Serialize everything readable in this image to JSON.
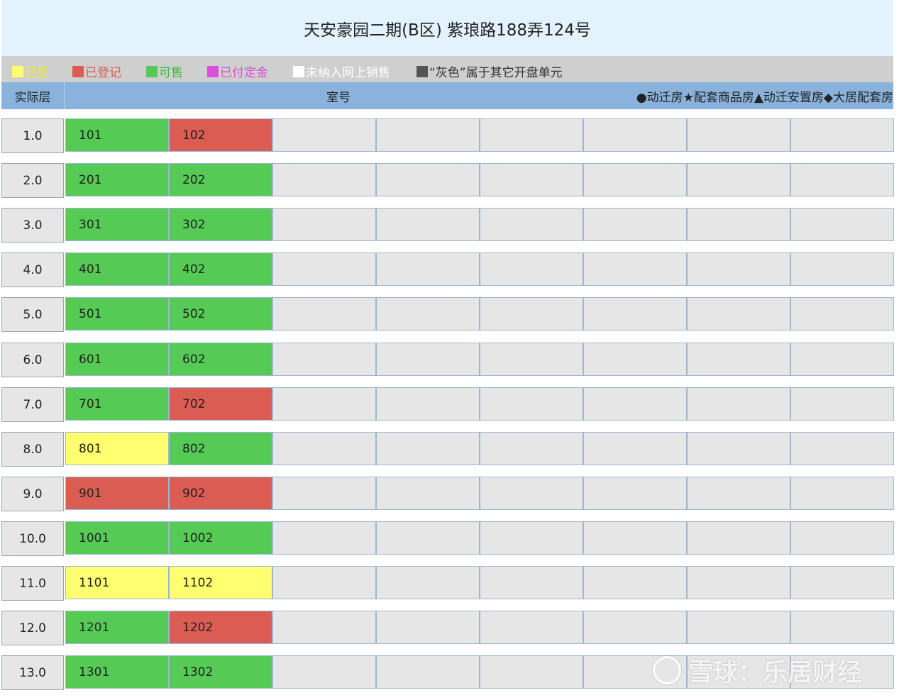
{
  "title": "天安豪园二期(B区) 紫琅路188弄124号",
  "legend": [
    {
      "label": "已签",
      "color": "#ffff70",
      "text_color": "#e6e600"
    },
    {
      "label": "已登记",
      "color": "#db5c53",
      "text_color": "#db5c53"
    },
    {
      "label": "可售",
      "color": "#55cb55",
      "text_color": "#3fb83f"
    },
    {
      "label": "已付定金",
      "color": "#d94fd9",
      "text_color": "#d94fd9"
    },
    {
      "label": "未纳入网上销售",
      "color": "#ffffff",
      "text_color": "#ffffff"
    },
    {
      "label": "“灰色”属于其它开盘单元",
      "color": "#555555",
      "text_color": "#333333"
    }
  ],
  "header": {
    "floor_label": "实际层",
    "room_label": "室号",
    "type_legend": "●动迁房★配套商品房▲动迁安置房◆大居配套房"
  },
  "rows": [
    {
      "floor": "1.0",
      "units": [
        {
          "num": "101",
          "status": "green"
        },
        {
          "num": "102",
          "status": "red"
        }
      ]
    },
    {
      "floor": "2.0",
      "units": [
        {
          "num": "201",
          "status": "green"
        },
        {
          "num": "202",
          "status": "green"
        }
      ]
    },
    {
      "floor": "3.0",
      "units": [
        {
          "num": "301",
          "status": "green"
        },
        {
          "num": "302",
          "status": "green"
        }
      ]
    },
    {
      "floor": "4.0",
      "units": [
        {
          "num": "401",
          "status": "green"
        },
        {
          "num": "402",
          "status": "green"
        }
      ]
    },
    {
      "floor": "5.0",
      "units": [
        {
          "num": "501",
          "status": "green"
        },
        {
          "num": "502",
          "status": "green"
        }
      ]
    },
    {
      "floor": "6.0",
      "units": [
        {
          "num": "601",
          "status": "green"
        },
        {
          "num": "602",
          "status": "green"
        }
      ]
    },
    {
      "floor": "7.0",
      "units": [
        {
          "num": "701",
          "status": "green"
        },
        {
          "num": "702",
          "status": "red"
        }
      ]
    },
    {
      "floor": "8.0",
      "units": [
        {
          "num": "801",
          "status": "yellow"
        },
        {
          "num": "802",
          "status": "green"
        }
      ]
    },
    {
      "floor": "9.0",
      "units": [
        {
          "num": "901",
          "status": "red"
        },
        {
          "num": "902",
          "status": "red"
        }
      ]
    },
    {
      "floor": "10.0",
      "units": [
        {
          "num": "1001",
          "status": "green"
        },
        {
          "num": "1002",
          "status": "green"
        }
      ]
    },
    {
      "floor": "11.0",
      "units": [
        {
          "num": "1101",
          "status": "yellow"
        },
        {
          "num": "1102",
          "status": "yellow"
        }
      ]
    },
    {
      "floor": "12.0",
      "units": [
        {
          "num": "1201",
          "status": "green"
        },
        {
          "num": "1202",
          "status": "red"
        }
      ]
    },
    {
      "floor": "13.0",
      "units": [
        {
          "num": "1301",
          "status": "green"
        },
        {
          "num": "1302",
          "status": "green"
        }
      ]
    }
  ],
  "watermark": "雪球：乐居财经"
}
